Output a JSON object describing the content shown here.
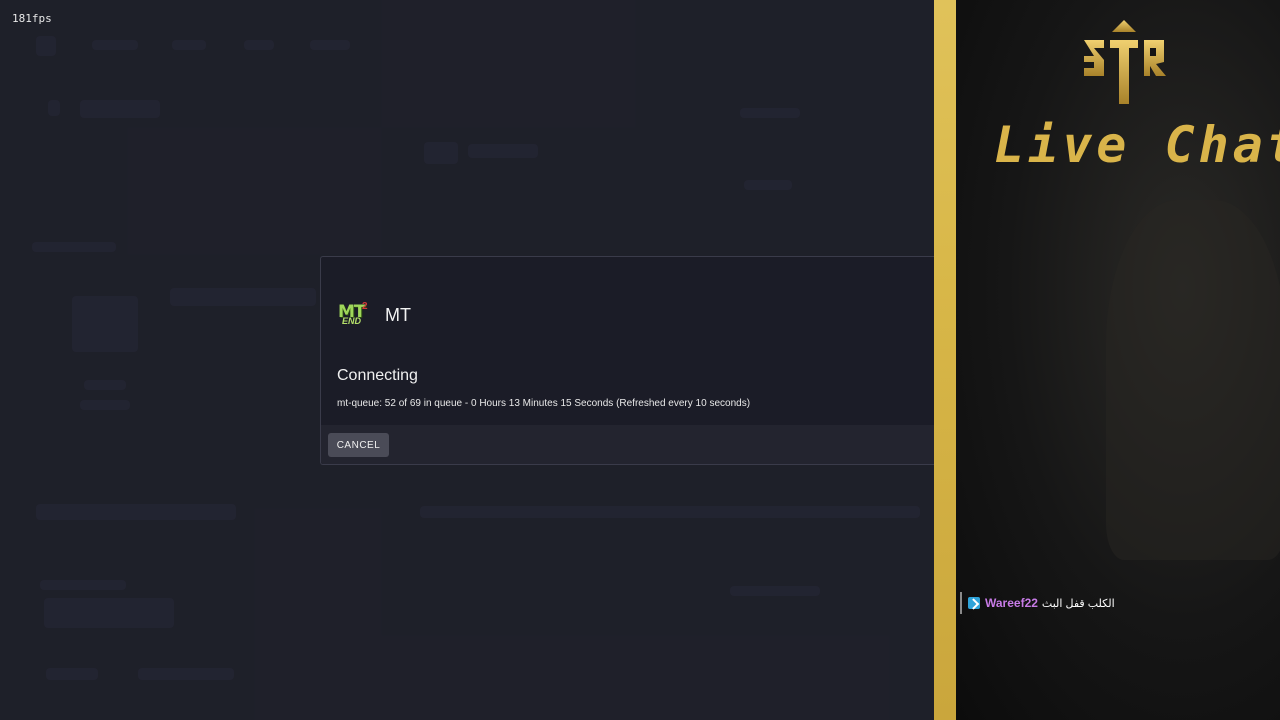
{
  "overlay": {
    "fps": "181fps"
  },
  "dialog": {
    "server_name": "MT",
    "status": "Connecting",
    "queue_message": "mt-queue: 52 of 69 in queue - 0 Hours 13 Minutes 15 Seconds (Refreshed every 10 seconds)",
    "cancel_label": "CANCEL"
  },
  "chat_panel": {
    "title": "Live Chat",
    "logo_text": "3TR",
    "messages": [
      {
        "user": "Wareef22",
        "text": "الكلب قفل البث"
      }
    ]
  },
  "colors": {
    "accent_gold": "#d9b44a",
    "username": "#c77be6",
    "badge": "#2fa3d9"
  }
}
